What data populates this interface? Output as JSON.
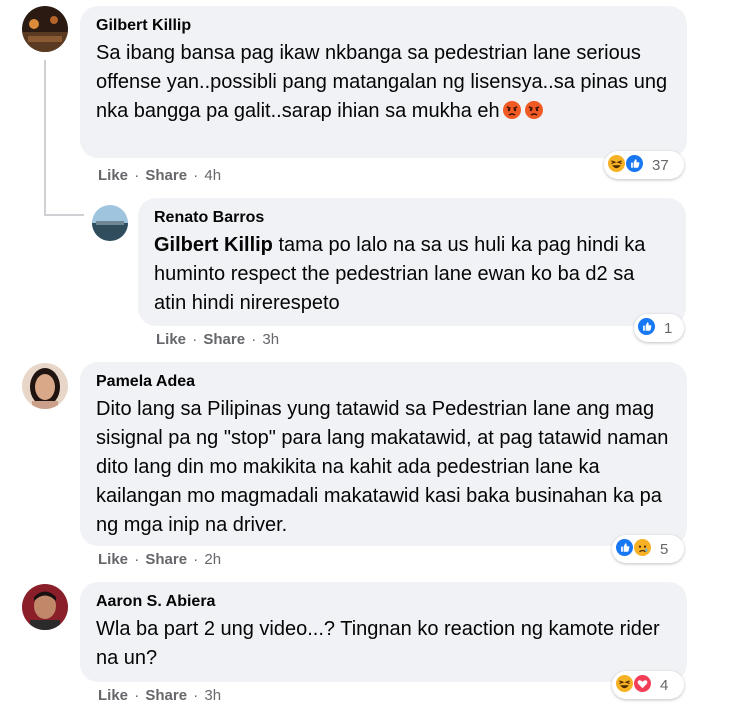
{
  "comments": [
    {
      "author": "Gilbert Killip",
      "text": "Sa ibang bansa pag ikaw nkbanga sa pedestrian lane serious offense yan..possibli pang matangalan ng lisensya..sa pinas ung nka bangga pa galit..sarap ihian sa mukha eh",
      "inline_emojis": [
        "angry-emoji",
        "angry-emoji"
      ],
      "like": "Like",
      "share": "Share",
      "time": "4h",
      "reactions": [
        "haha",
        "like"
      ],
      "reaction_count": "37"
    },
    {
      "author": "Renato Barros",
      "mention": "Gilbert Killip",
      "text": " tama po lalo na sa us huli ka pag hindi ka huminto respect the pedestrian lane ewan ko ba d2 sa atin hindi nirerespeto",
      "like": "Like",
      "share": "Share",
      "time": "3h",
      "reactions": [
        "like"
      ],
      "reaction_count": "1"
    },
    {
      "author": "Pamela Adea",
      "text": "Dito lang sa Pilipinas yung tatawid sa Pedestrian lane ang mag sisignal pa ng \"stop\" para lang makatawid, at pag tatawid naman dito lang din mo makikita na kahit ada pedestrian lane ka kailangan mo magmadali makatawid kasi baka businahan ka pa ng mga inip na driver.",
      "like": "Like",
      "share": "Share",
      "time": "2h",
      "reactions": [
        "like",
        "sad"
      ],
      "reaction_count": "5"
    },
    {
      "author": "Aaron S. Abiera",
      "text": "Wla ba part 2 ung video...? Tingnan ko reaction ng kamote rider na un?",
      "like": "Like",
      "share": "Share",
      "time": "3h",
      "reactions": [
        "haha",
        "love"
      ],
      "reaction_count": "4"
    }
  ],
  "separator": "·",
  "colors": {
    "bubble": "#f0f2f5",
    "meta": "#65676b",
    "like": "#1877f2",
    "thread": "#ced0d4"
  }
}
